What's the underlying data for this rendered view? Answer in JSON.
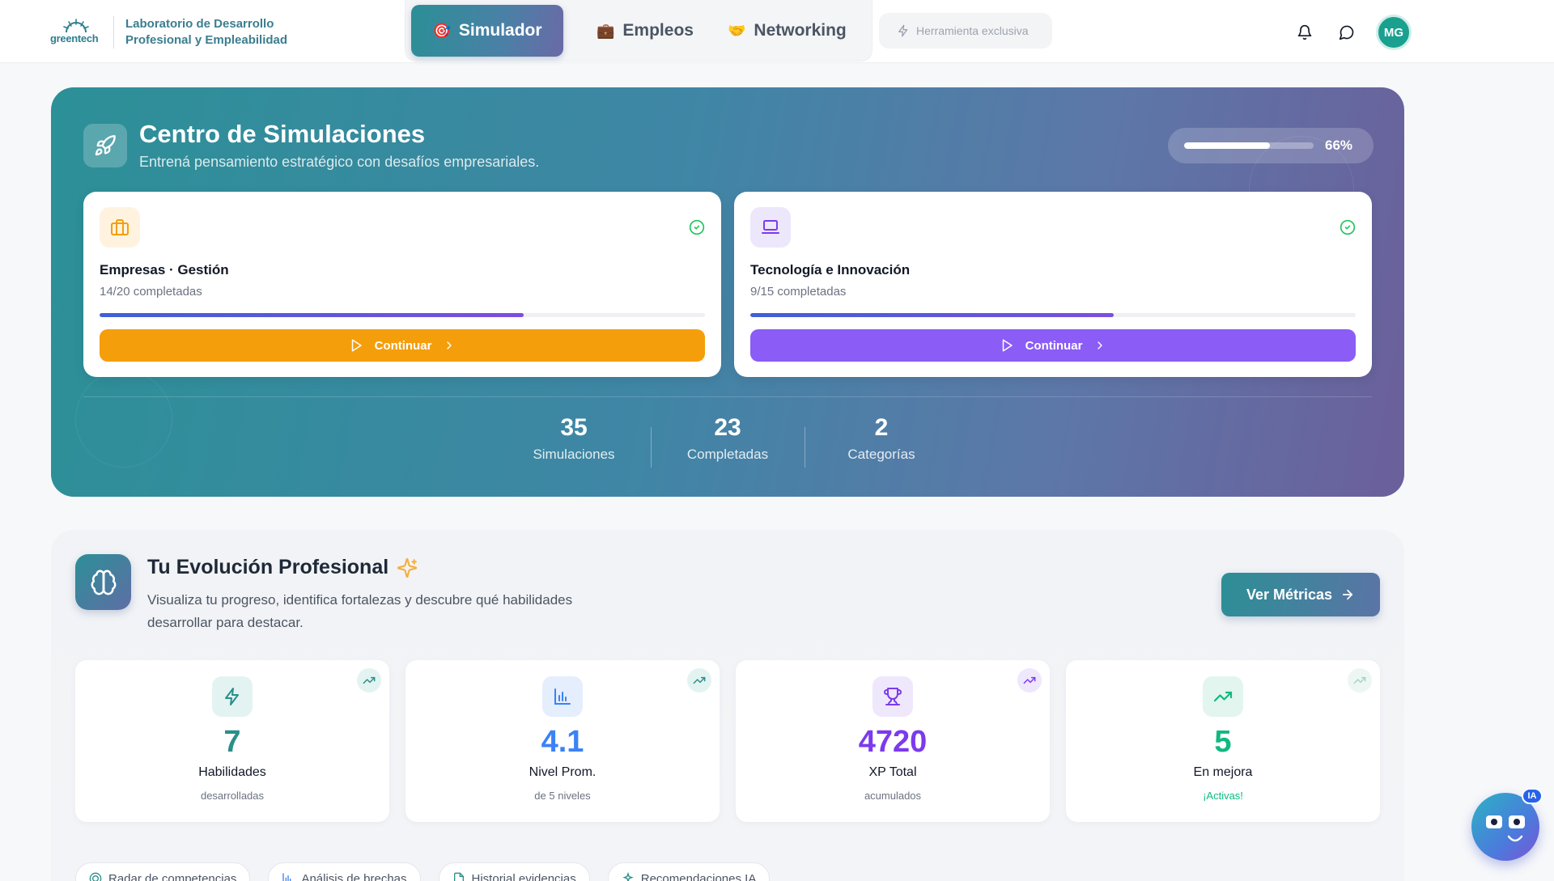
{
  "header": {
    "brand_logo_text": "greentech",
    "brand_title": "Laboratorio de Desarrollo Profesional y Empleabilidad",
    "tabs": [
      {
        "label": "Simulador",
        "emoji": "🎯",
        "active": true
      },
      {
        "label": "Empleos",
        "emoji": "💼",
        "active": false
      },
      {
        "label": "Networking",
        "emoji": "🤝",
        "active": false
      }
    ],
    "exclusive_label": "Herramienta exclusiva",
    "avatar_initials": "MG"
  },
  "hero": {
    "title": "Centro de Simulaciones",
    "subtitle": "Entrená pensamiento estratégico con desafíos empresariales.",
    "progress_text": "66%",
    "progress_value": 0.66,
    "cards": [
      {
        "title": "Empresas · Gestión",
        "subtitle": "14/20 completadas",
        "progress": 0.7,
        "button": "Continuar",
        "accent": "#f59e0b"
      },
      {
        "title": "Tecnología e Innovación",
        "subtitle": "9/15 completadas",
        "progress": 0.6,
        "button": "Continuar",
        "accent": "#8b5cf6"
      }
    ],
    "stats": [
      {
        "value": "35",
        "label": "Simulaciones"
      },
      {
        "value": "23",
        "label": "Completadas"
      },
      {
        "value": "2",
        "label": "Categorías"
      }
    ]
  },
  "evolution": {
    "title": "Tu Evolución Profesional",
    "description": "Visualiza tu progreso, identifica fortalezas y descubre qué habilidades desarrollar para destacar.",
    "button": "Ver Métricas",
    "metrics": [
      {
        "value": "7",
        "label": "Habilidades",
        "sub": "desarrolladas",
        "color": "#2a8f8a",
        "icon": "bolt-icon"
      },
      {
        "value": "4.1",
        "label": "Nivel Prom.",
        "sub": "de 5 niveles",
        "color": "#3b82f6",
        "icon": "bar-chart-icon"
      },
      {
        "value": "4720",
        "label": "XP Total",
        "sub": "acumulados",
        "color": "#7c3aed",
        "icon": "trophy-icon"
      },
      {
        "value": "5",
        "label": "En mejora",
        "sub": "¡Activas!",
        "color": "#10b981",
        "icon": "trending-up-icon"
      }
    ],
    "chips": [
      "Radar de competencias",
      "Análisis de brechas",
      "Historial evidencias",
      "Recomendaciones IA"
    ]
  },
  "assistant": {
    "badge": "IA"
  }
}
